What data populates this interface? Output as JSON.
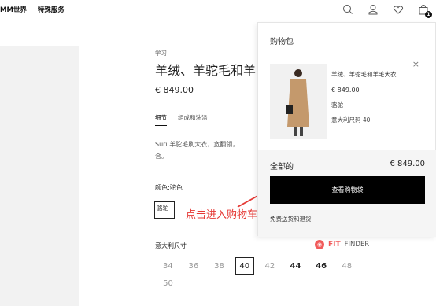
{
  "header": {
    "nav": [
      "MM世界",
      "特殊服务"
    ],
    "icons": [
      "search-icon",
      "user-icon",
      "heart-icon",
      "bag-icon"
    ],
    "bag_count": "1"
  },
  "product": {
    "category": "学习",
    "title": "羊绒、羊驼毛和羊",
    "price": "€ 849.00",
    "tabs": [
      "细节",
      "组成和洗涤"
    ],
    "description": "Suri 羊驼毛刷大衣，宽翻领，\n合。",
    "color_label": "颜色:驼色",
    "color_swatch": "骆驼",
    "size_label": "意大利尺寸",
    "sizes_row1": [
      {
        "label": "34",
        "state": "unavailable"
      },
      {
        "label": "36",
        "state": "unavailable"
      },
      {
        "label": "38",
        "state": "unavailable"
      },
      {
        "label": "40",
        "state": "selected"
      },
      {
        "label": "42",
        "state": "unavailable"
      },
      {
        "label": "44",
        "state": "available"
      },
      {
        "label": "46",
        "state": "available"
      },
      {
        "label": "48",
        "state": "unavailable"
      }
    ],
    "sizes_row2": [
      {
        "label": "50",
        "state": "unavailable"
      }
    ],
    "fit_finder": {
      "fit": "FIT",
      "finder": "FINDER"
    }
  },
  "annotation": {
    "text": "点击进入购物车",
    "color": "#e53935"
  },
  "bag": {
    "title": "购物包",
    "close": "×",
    "item": {
      "name": "羊绒、羊驼毛和羊毛大衣",
      "price": "€ 849.00",
      "color": "骆驼",
      "size": "意大利尺码 40"
    },
    "total_label": "全部的",
    "total_value": "€ 849.00",
    "checkout_label": "查看购物袋",
    "shipping_note": "免费送货和退货"
  },
  "colors": {
    "accent": "#000000",
    "coat": "#c4996c",
    "fit_finder": "#f15b5b"
  }
}
